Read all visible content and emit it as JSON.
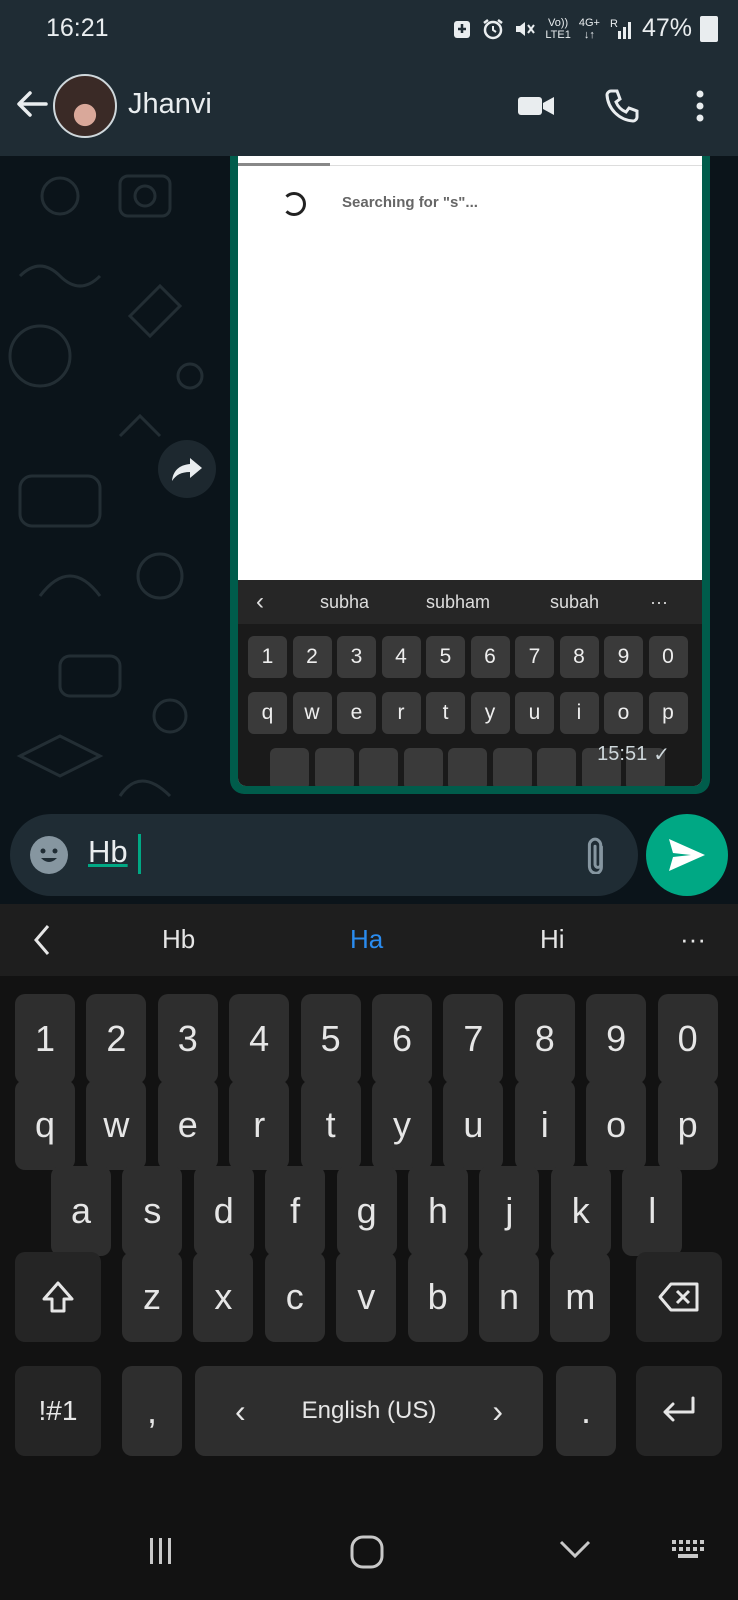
{
  "status_bar": {
    "time": "16:21",
    "volte_top": "Vo))",
    "volte_bottom": "LTE1",
    "network": "4G+",
    "roaming": "R",
    "battery": "47%"
  },
  "header": {
    "contact_name": "Jhanvi",
    "icons": [
      "back-arrow-icon",
      "avatar",
      "video-call-icon",
      "voice-call-icon",
      "more-options-icon"
    ]
  },
  "message": {
    "screenshot": {
      "searching_text": "Searching for \"s\"...",
      "suggestions": [
        "subha",
        "subham",
        "subah"
      ],
      "more": "···",
      "number_row": [
        "1",
        "2",
        "3",
        "4",
        "5",
        "6",
        "7",
        "8",
        "9",
        "0"
      ],
      "letter_row": [
        "q",
        "w",
        "e",
        "r",
        "t",
        "y",
        "u",
        "i",
        "o",
        "p"
      ]
    },
    "time": "15:51",
    "tick": "✓"
  },
  "composer": {
    "text": "Hb"
  },
  "keyboard": {
    "suggestions": [
      "Hb",
      "Ha",
      "Hi"
    ],
    "suggestion_more": "···",
    "highlight_color": "#2a8cf0",
    "numbers": [
      "1",
      "2",
      "3",
      "4",
      "5",
      "6",
      "7",
      "8",
      "9",
      "0"
    ],
    "row1": [
      "q",
      "w",
      "e",
      "r",
      "t",
      "y",
      "u",
      "i",
      "o",
      "p"
    ],
    "row2": [
      "a",
      "s",
      "d",
      "f",
      "g",
      "h",
      "j",
      "k",
      "l"
    ],
    "row3": [
      "z",
      "x",
      "c",
      "v",
      "b",
      "n",
      "m"
    ],
    "symbols_label": "!#1",
    "comma": ",",
    "space_label": "English (US)",
    "space_left": "‹",
    "space_right": "›",
    "period": "."
  },
  "colors": {
    "accent": "#00a884",
    "header_bg": "#1f2c34",
    "chat_bg": "#0b141a",
    "bubble": "#005c4b"
  }
}
